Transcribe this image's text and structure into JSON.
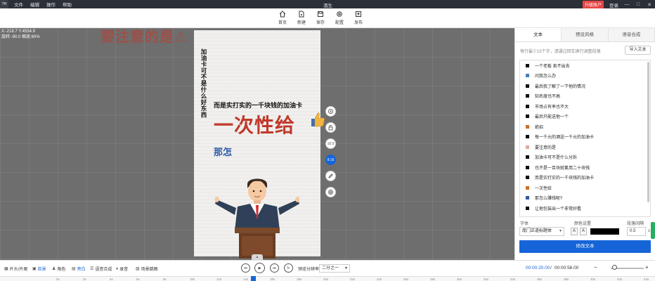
{
  "titlebar": {
    "logo": "TH",
    "menu": [
      "文件",
      "编辑",
      "操作",
      "帮助"
    ],
    "window_title": "酒生",
    "vip": "升级账户",
    "login": "登录",
    "min": "—",
    "max": "□",
    "close": "✕"
  },
  "toolbar": {
    "home": "首页",
    "new": "新建",
    "save": "保存",
    "config": "配置",
    "publish": "发布"
  },
  "canvas": {
    "coords_line1": "X:-218.7 Y:4554.9",
    "coords_line2": "旋转:-90.0 缩放:60%",
    "ghost_text": "要注意的是⚠",
    "vertical_text": "加油卡可不是什么好东西",
    "sub_text": "而是实打实的一千块钱的加油卡",
    "big_text": "一次性给",
    "small_text": "那怎"
  },
  "float_buttons": {
    "ratio_16_9": "16:9",
    "ratio_9_16": "9:16"
  },
  "panel": {
    "tabs": [
      "文本",
      "预设风格",
      "语音合成"
    ],
    "active_tab": 0,
    "hint": "每行最少15个字，请通过回车换行调整段落",
    "import_label": "导入文本",
    "items": [
      {
        "text": "一个老板  卖不出去",
        "color": "#111111"
      },
      {
        "text": "问我怎么办",
        "color": "#4a7fb5"
      },
      {
        "text": "最后我了解了一下他的情况",
        "color": "#111111"
      },
      {
        "text": "知名度也不高",
        "color": "#111111"
      },
      {
        "text": "市场占有率也不大",
        "color": "#111111"
      },
      {
        "text": "最后只能送他一个",
        "color": "#111111"
      },
      {
        "text": "绝招",
        "color": "#c8702a"
      },
      {
        "text": "每一千元的酒送一千元的加油卡",
        "color": "#111111"
      },
      {
        "text": "要注意的是",
        "color": "#e0a8a0"
      },
      {
        "text": "加油卡可不是什么分拆",
        "color": "#111111"
      },
      {
        "text": "也不是一百块就氪用二十块钱",
        "color": "#111111"
      },
      {
        "text": "而是实打实的一千块钱的加油卡",
        "color": "#111111"
      },
      {
        "text": "一次性给",
        "color": "#c8702a"
      },
      {
        "text": "那怎么赚钱呢?",
        "color": "#2e5aa8"
      },
      {
        "text": "让他包装出一个非常好看",
        "color": "#111111"
      }
    ],
    "font_label": "字体",
    "font_value": "庞门正道标题体",
    "color_label": "颜色设置",
    "spacing_label": "段落间隔",
    "spacing_value": "0.5",
    "spacing_unit": "s",
    "text_color": "#000000",
    "fmt_a1": "A",
    "fmt_a2": "A",
    "modify_label": "修改文本"
  },
  "bottombar": {
    "items": [
      "片头/片尾",
      "前景",
      "角色",
      "旁白",
      "语音合成",
      "录音",
      "场景跳图"
    ],
    "active_items": [
      1,
      3
    ],
    "ratio_label": "预览分辨率",
    "ratio_value": "二分之一",
    "time_current": "00:00:20.00",
    "time_sep": "/",
    "time_total": "00:00:58.00"
  },
  "ruler": {
    "ticks": [
      "0s",
      "2s",
      "4s",
      "6s",
      "8s",
      "10s",
      "12s",
      "14s",
      "16s",
      "18s",
      "20s",
      "22s",
      "24s",
      "26s",
      "28s",
      "30s",
      "32s",
      "34s",
      "36s",
      "38s",
      "40s",
      "42s",
      "44s",
      "46s"
    ]
  }
}
